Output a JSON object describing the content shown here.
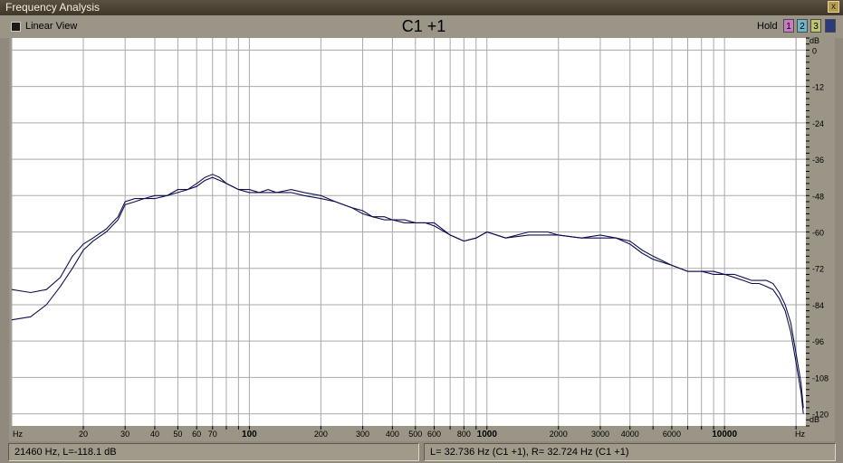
{
  "window": {
    "title": "Frequency Analysis",
    "close_label": "x"
  },
  "toolbar": {
    "linear_view_label": "Linear View",
    "chart_title": "C1 +1",
    "hold_label": "Hold",
    "hold_buttons": [
      {
        "label": "1",
        "color": "#c77bc0"
      },
      {
        "label": "2",
        "color": "#6fb6c8"
      },
      {
        "label": "3",
        "color": "#bfc46f"
      }
    ]
  },
  "status": {
    "left": "21460 Hz, L=-118.1 dB",
    "right": "L= 32.736 Hz (C1 +1), R= 32.724 Hz (C1 +1)"
  },
  "colors": {
    "curve": "#101050",
    "grid": "#a9a9a9",
    "plot_bg": "#ffffff",
    "frame": "#9a9587"
  },
  "chart_data": {
    "type": "line",
    "title": "C1 +1",
    "x_scale": "log",
    "xlim": [
      10,
      22000
    ],
    "ylim": [
      -124,
      4
    ],
    "x_unit": "Hz",
    "y_unit": "dB",
    "x_ticks": [
      {
        "v": 20,
        "label": "20"
      },
      {
        "v": 30,
        "label": "30"
      },
      {
        "v": 40,
        "label": "40"
      },
      {
        "v": 50,
        "label": "50"
      },
      {
        "v": 60,
        "label": "60"
      },
      {
        "v": 70,
        "label": "70"
      },
      {
        "v": 100,
        "label": "100"
      },
      {
        "v": 200,
        "label": "200"
      },
      {
        "v": 300,
        "label": "300"
      },
      {
        "v": 400,
        "label": "400"
      },
      {
        "v": 500,
        "label": "500"
      },
      {
        "v": 600,
        "label": "600"
      },
      {
        "v": 800,
        "label": "800"
      },
      {
        "v": 1000,
        "label": "1000"
      },
      {
        "v": 2000,
        "label": "2000"
      },
      {
        "v": 3000,
        "label": "3000"
      },
      {
        "v": 4000,
        "label": "4000"
      },
      {
        "v": 6000,
        "label": "6000"
      },
      {
        "v": 10000,
        "label": "10000"
      }
    ],
    "y_ticks": [
      0,
      -12,
      -24,
      -36,
      -48,
      -60,
      -72,
      -84,
      -96,
      -108,
      -120
    ],
    "y_tick_labels": [
      "0",
      "-12",
      "-24",
      "-36",
      "-48",
      "-60",
      "-72",
      "-84",
      "-96",
      "-108",
      "-120"
    ],
    "grid": true,
    "series": [
      {
        "x": [
          10,
          12,
          14,
          16,
          18,
          20,
          22,
          25,
          28,
          30,
          33,
          36,
          40,
          45,
          50,
          55,
          60,
          65,
          70,
          75,
          80,
          90,
          100,
          110,
          120,
          130,
          150,
          170,
          200,
          230,
          270,
          300,
          330,
          370,
          400,
          450,
          500,
          550,
          600,
          700,
          800,
          900,
          1000,
          1200,
          1500,
          1800,
          2000,
          2500,
          3000,
          3500,
          4000,
          4500,
          5000,
          6000,
          7000,
          8000,
          9000,
          10000,
          11000,
          12000,
          13000,
          14000,
          15000,
          16000,
          17000,
          18000,
          19000,
          20000,
          21000,
          21460
        ],
        "y": [
          -79,
          -80,
          -79,
          -75,
          -68,
          -64,
          -62,
          -59,
          -55,
          -50,
          -49,
          -49,
          -48,
          -48,
          -46,
          -46,
          -44,
          -42,
          -41,
          -42,
          -44,
          -46,
          -46,
          -47,
          -46,
          -47,
          -46,
          -47,
          -48,
          -50,
          -52,
          -53,
          -55,
          -55,
          -56,
          -56,
          -57,
          -57,
          -57,
          -61,
          -63,
          -62,
          -60,
          -62,
          -60,
          -60,
          -61,
          -62,
          -61,
          -62,
          -63,
          -66,
          -68,
          -71,
          -73,
          -73,
          -73,
          -74,
          -74,
          -75,
          -76,
          -76,
          -76,
          -77,
          -80,
          -84,
          -90,
          -100,
          -110,
          -118.1
        ]
      },
      {
        "x": [
          10,
          12,
          14,
          16,
          18,
          20,
          22,
          25,
          28,
          30,
          33,
          36,
          40,
          45,
          50,
          55,
          60,
          65,
          70,
          75,
          80,
          90,
          100,
          110,
          120,
          130,
          150,
          170,
          200,
          230,
          270,
          300,
          330,
          370,
          400,
          450,
          500,
          550,
          600,
          700,
          800,
          900,
          1000,
          1200,
          1500,
          1800,
          2000,
          2500,
          3000,
          3500,
          4000,
          4500,
          5000,
          6000,
          7000,
          8000,
          9000,
          10000,
          11000,
          12000,
          13000,
          14000,
          15000,
          16000,
          17000,
          18000,
          19000,
          20000,
          21000,
          21460
        ],
        "y": [
          -89,
          -88,
          -84,
          -78,
          -72,
          -66,
          -63,
          -60,
          -56,
          -51,
          -50,
          -49,
          -49,
          -48,
          -47,
          -46,
          -45,
          -43,
          -42,
          -43,
          -44,
          -46,
          -47,
          -47,
          -47,
          -47,
          -47,
          -48,
          -49,
          -50,
          -52,
          -54,
          -55,
          -56,
          -56,
          -57,
          -57,
          -57,
          -58,
          -61,
          -63,
          -62,
          -60,
          -62,
          -61,
          -61,
          -61,
          -62,
          -62,
          -62,
          -64,
          -67,
          -69,
          -71,
          -73,
          -73,
          -74,
          -74,
          -75,
          -76,
          -77,
          -77,
          -78,
          -79,
          -82,
          -86,
          -93,
          -103,
          -113,
          -120
        ]
      }
    ]
  }
}
